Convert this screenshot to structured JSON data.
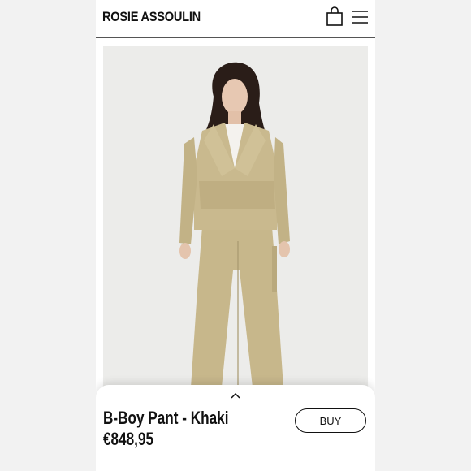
{
  "header": {
    "brand": "ROSIE ASSOULIN",
    "bag_icon": "shopping-bag-icon",
    "menu_icon": "hamburger-menu-icon"
  },
  "product": {
    "name": "B-Boy Pant - Khaki",
    "price": "€848,95",
    "buy_label": "BUY",
    "expand_icon": "chevron-up-icon",
    "colors": {
      "khaki": "#c8b88c",
      "background": "#ececea"
    }
  }
}
